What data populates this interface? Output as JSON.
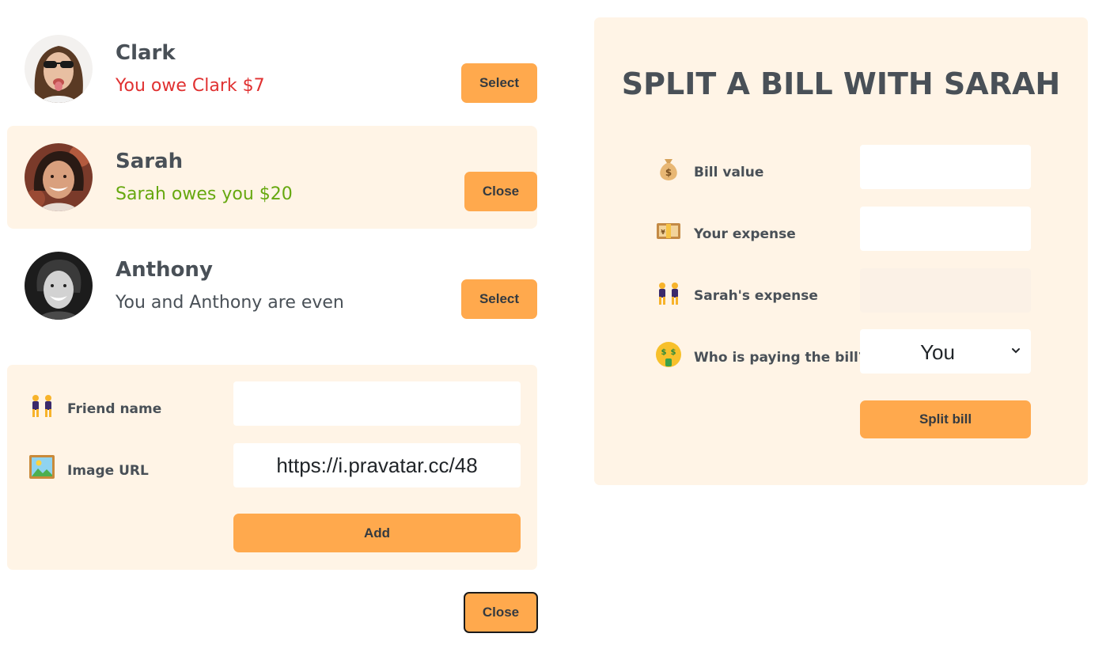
{
  "friends": [
    {
      "name": "Clark",
      "status": "You owe Clark $7",
      "button": "Select"
    },
    {
      "name": "Sarah",
      "status": "Sarah owes you $20",
      "button": "Close"
    },
    {
      "name": "Anthony",
      "status": "You and Anthony are even",
      "button": "Select"
    }
  ],
  "add_form": {
    "name_label": "Friend name",
    "name_value": "",
    "image_label": "Image URL",
    "image_value": "https://i.pravatar.cc/48",
    "submit": "Add"
  },
  "close_button": "Close",
  "split_form": {
    "title": "SPLIT A BILL WITH SARAH",
    "bill_label": "Bill value",
    "bill_value": "",
    "your_expense_label": "Your expense",
    "your_expense_value": "",
    "friend_expense_label": "Sarah's expense",
    "friend_expense_value": "",
    "payer_label": "Who is paying the bill?",
    "payer_value": "You",
    "submit": "Split bill"
  },
  "colors": {
    "accent": "#ffa94d",
    "panel": "#fff4e6",
    "owe_red": "#e03131",
    "owed_green": "#66a80f"
  },
  "icons": [
    "money-bag-icon",
    "banknote-icon",
    "two-people-icon",
    "money-face-icon",
    "framed-picture-icon",
    "chevron-down-icon"
  ]
}
